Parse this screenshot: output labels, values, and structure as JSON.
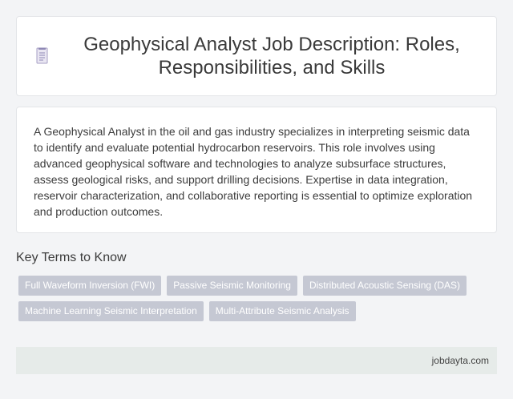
{
  "header": {
    "title": "Geophysical Analyst Job Description: Roles, Responsibilities, and Skills",
    "icon": "document-icon"
  },
  "description": {
    "text": "A Geophysical Analyst in the oil and gas industry specializes in interpreting seismic data to identify and evaluate potential hydrocarbon reservoirs. This role involves using advanced geophysical software and technologies to analyze subsurface structures, assess geological risks, and support drilling decisions. Expertise in data integration, reservoir characterization, and collaborative reporting is essential to optimize exploration and production outcomes."
  },
  "key_terms": {
    "heading": "Key Terms to Know",
    "tags": [
      "Full Waveform Inversion (FWI)",
      "Passive Seismic Monitoring",
      "Distributed Acoustic Sensing (DAS)",
      "Machine Learning Seismic Interpretation",
      "Multi-Attribute Seismic Analysis"
    ]
  },
  "footer": {
    "site": "jobdayta.com"
  },
  "colors": {
    "tag_background": "#c5c8d3",
    "footer_background": "#e6ebe9",
    "card_background": "#ffffff",
    "page_background": "#f3f4f6"
  }
}
